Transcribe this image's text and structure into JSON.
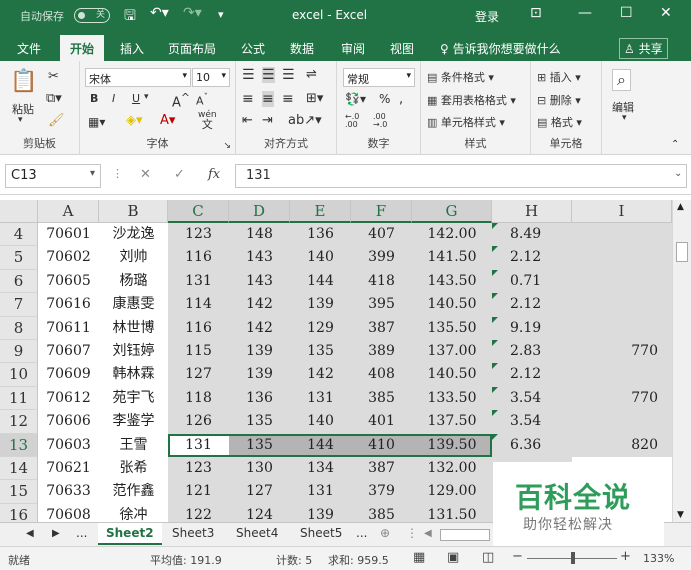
{
  "titlebar": {
    "autosave_label": "自动保存",
    "autosave_state": "关",
    "title": "excel  -  Excel",
    "login": "登录"
  },
  "tabs": [
    {
      "label": "文件",
      "active": false
    },
    {
      "label": "开始",
      "active": true
    },
    {
      "label": "插入",
      "active": false
    },
    {
      "label": "页面布局",
      "active": false
    },
    {
      "label": "公式",
      "active": false
    },
    {
      "label": "数据",
      "active": false
    },
    {
      "label": "审阅",
      "active": false
    },
    {
      "label": "视图",
      "active": false
    }
  ],
  "tellme": "告诉我你想要做什么",
  "share": "共享",
  "ribbon": {
    "paste": "粘贴",
    "clipboard": "剪贴板",
    "font_name": "宋体",
    "font_size": "10",
    "font_group": "字体",
    "align_group": "对齐方式",
    "number_format": "常规",
    "number_group": "数字",
    "cond_format": "条件格式",
    "table_format": "套用表格格式",
    "cell_style": "单元格样式",
    "style_group": "样式",
    "insert": "插入",
    "delete": "删除",
    "format": "格式",
    "cells_group": "单元格",
    "edit": "编辑",
    "bold": "B",
    "italic": "I",
    "underline": "U",
    "grow_font": "A",
    "shrink_font": "A",
    "font_color_glyph": "A",
    "wen": "wén",
    "wen_char": "文",
    "percent": "%",
    "comma": ",",
    "inc_decimal": "←.0",
    "inc_decimal2": ".00",
    "dec_decimal": ".00",
    "dec_decimal2": "→.0"
  },
  "formula": {
    "name_box": "C13",
    "value": "131",
    "fx": "fx"
  },
  "columns": [
    "A",
    "B",
    "C",
    "D",
    "E",
    "F",
    "G",
    "H",
    "I"
  ],
  "rows": [
    {
      "n": "4",
      "a": "70601",
      "b": "沙龙逸",
      "c": "123",
      "d": "148",
      "e": "136",
      "f": "407",
      "g": "142.00",
      "h": "8.49",
      "i": ""
    },
    {
      "n": "5",
      "a": "70602",
      "b": "刘帅",
      "c": "116",
      "d": "143",
      "e": "140",
      "f": "399",
      "g": "141.50",
      "h": "2.12",
      "i": ""
    },
    {
      "n": "6",
      "a": "70605",
      "b": "杨璐",
      "c": "131",
      "d": "143",
      "e": "144",
      "f": "418",
      "g": "143.50",
      "h": "0.71",
      "i": ""
    },
    {
      "n": "7",
      "a": "70616",
      "b": "康惠雯",
      "c": "114",
      "d": "142",
      "e": "139",
      "f": "395",
      "g": "140.50",
      "h": "2.12",
      "i": ""
    },
    {
      "n": "8",
      "a": "70611",
      "b": "林世博",
      "c": "116",
      "d": "142",
      "e": "129",
      "f": "387",
      "g": "135.50",
      "h": "9.19",
      "i": ""
    },
    {
      "n": "9",
      "a": "70607",
      "b": "刘钰婷",
      "c": "115",
      "d": "139",
      "e": "135",
      "f": "389",
      "g": "137.00",
      "h": "2.83",
      "i": "770"
    },
    {
      "n": "10",
      "a": "70609",
      "b": "韩林霖",
      "c": "127",
      "d": "139",
      "e": "142",
      "f": "408",
      "g": "140.50",
      "h": "2.12",
      "i": ""
    },
    {
      "n": "11",
      "a": "70612",
      "b": "苑宇飞",
      "c": "118",
      "d": "136",
      "e": "131",
      "f": "385",
      "g": "133.50",
      "h": "3.54",
      "i": "770"
    },
    {
      "n": "12",
      "a": "70606",
      "b": "李鉴学",
      "c": "126",
      "d": "135",
      "e": "140",
      "f": "401",
      "g": "137.50",
      "h": "3.54",
      "i": ""
    },
    {
      "n": "13",
      "a": "70603",
      "b": "王雪",
      "c": "131",
      "d": "135",
      "e": "144",
      "f": "410",
      "g": "139.50",
      "h": "6.36",
      "i": "820"
    },
    {
      "n": "14",
      "a": "70621",
      "b": "张希",
      "c": "123",
      "d": "130",
      "e": "134",
      "f": "387",
      "g": "132.00",
      "h": "",
      "i": ""
    },
    {
      "n": "15",
      "a": "70633",
      "b": "范作鑫",
      "c": "121",
      "d": "127",
      "e": "131",
      "f": "379",
      "g": "129.00",
      "h": "",
      "i": ""
    },
    {
      "n": "16",
      "a": "70608",
      "b": "徐冲",
      "c": "122",
      "d": "124",
      "e": "139",
      "f": "385",
      "g": "131.50",
      "h": "",
      "i": ""
    }
  ],
  "sheets": [
    {
      "label": "Sheet2",
      "active": true
    },
    {
      "label": "Sheet3",
      "active": false
    },
    {
      "label": "Sheet4",
      "active": false
    },
    {
      "label": "Sheet5",
      "active": false
    }
  ],
  "sheet_more": "...",
  "status": {
    "ready": "就绪",
    "average": "平均值: 191.9",
    "count": "计数: 5",
    "sum": "求和: 959.5",
    "zoom": "133%"
  },
  "watermark": {
    "big": "百科全说",
    "small": "助你轻松解决"
  },
  "colors": {
    "accent": "#217346",
    "selection_gray": "#dcdcdc"
  }
}
